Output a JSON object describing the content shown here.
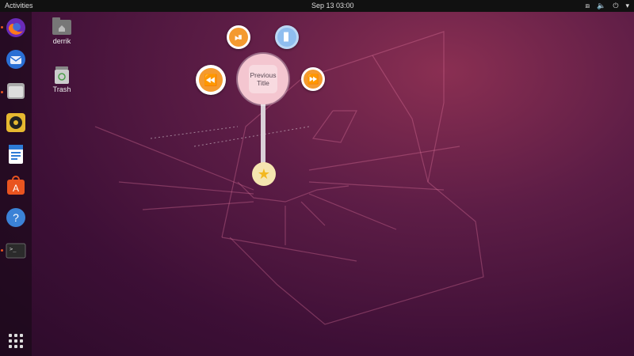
{
  "topbar": {
    "activities": "Activities",
    "clock": "Sep 13  03:00",
    "tray": {
      "network_icon": "⧈",
      "volume_icon": "🔈",
      "power_icon": "⏻",
      "menu_icon": "▾"
    }
  },
  "desktop": {
    "home_label": "derrik",
    "trash_label": "Trash"
  },
  "pie_menu": {
    "center_label": "Previous Title",
    "buttons": {
      "play_pause": "⏯",
      "rewind": "⏪",
      "forward": "⏩",
      "settings": "▊"
    },
    "star_glyph": "★"
  },
  "colors": {
    "accent": "#e95420",
    "pie_orange": "#f49a2f",
    "pie_center": "#f4c6d0"
  }
}
